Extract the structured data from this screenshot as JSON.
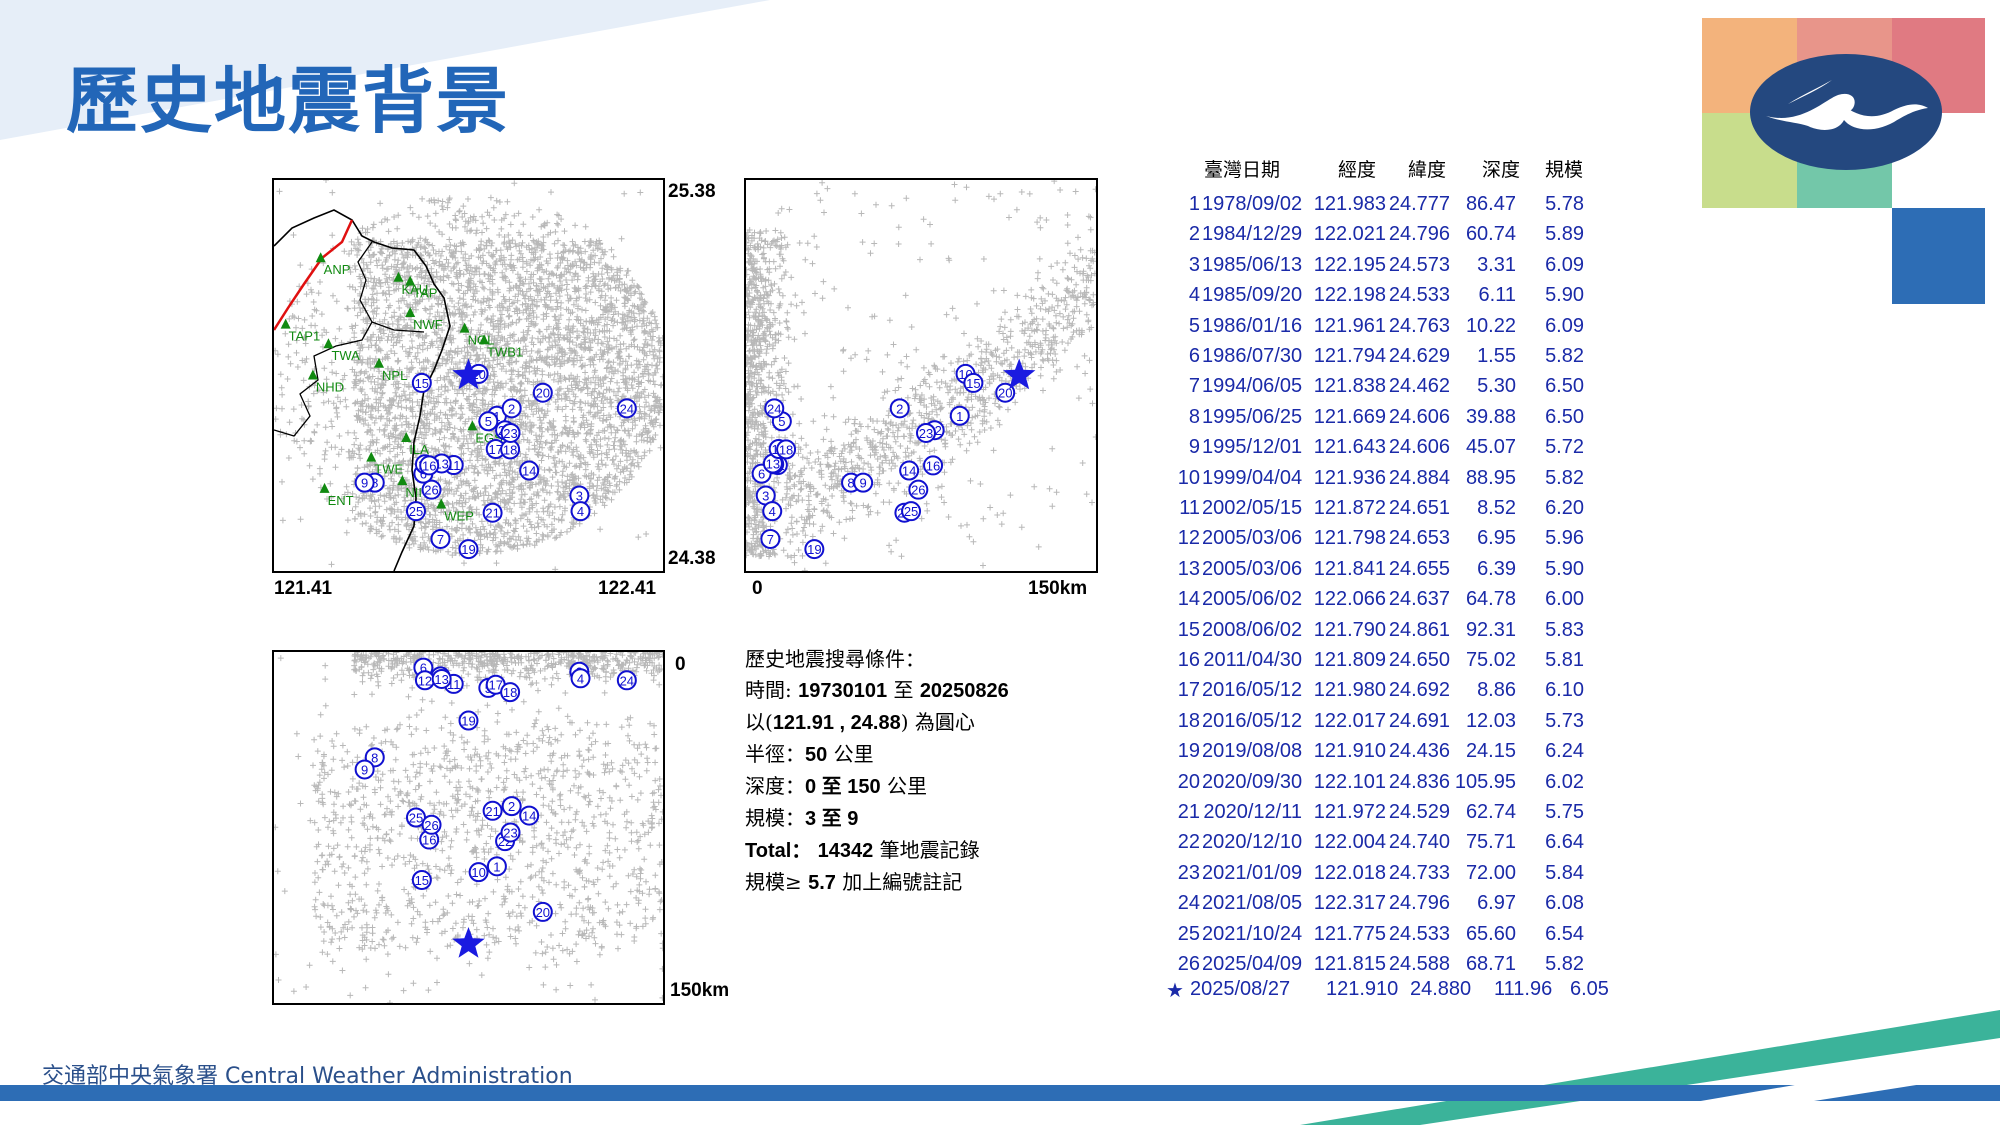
{
  "slide": {
    "title": "歷史地震背景",
    "footer": "交通部中央氣象署 Central Weather Administration",
    "colors": {
      "title": "#2266b8",
      "accent_blue": "#2d6db5",
      "accent_green": "#3bb39a",
      "logo_orange": "#f3b37c",
      "logo_pink": "#e4878a",
      "logo_lightgreen": "#c6dd8a",
      "logo_teal": "#73c7a9",
      "logo_navy": "#24487f"
    }
  },
  "map_plot": {
    "lat_top": "25.38",
    "lat_bottom": "24.38",
    "lon_left": "121.41",
    "lon_right": "122.41",
    "stations": [
      {
        "name": "ANP",
        "lon": 121.53,
        "lat": 25.18
      },
      {
        "name": "KAU",
        "lon": 121.73,
        "lat": 25.13
      },
      {
        "name": "TAP",
        "lon": 121.76,
        "lat": 25.12
      },
      {
        "name": "NWF",
        "lon": 121.76,
        "lat": 25.04
      },
      {
        "name": "NGL",
        "lon": 121.9,
        "lat": 25.0
      },
      {
        "name": "TWB1",
        "lon": 121.95,
        "lat": 24.97
      },
      {
        "name": "TAP1",
        "lon": 121.44,
        "lat": 25.01
      },
      {
        "name": "TWA",
        "lon": 121.55,
        "lat": 24.96
      },
      {
        "name": "NPL",
        "lon": 121.68,
        "lat": 24.91
      },
      {
        "name": "NHD",
        "lon": 121.51,
        "lat": 24.88
      },
      {
        "name": "EGS",
        "lon": 121.92,
        "lat": 24.75
      },
      {
        "name": "ILA",
        "lon": 121.75,
        "lat": 24.72
      },
      {
        "name": "TWE",
        "lon": 121.66,
        "lat": 24.67
      },
      {
        "name": "NII",
        "lon": 121.74,
        "lat": 24.61
      },
      {
        "name": "ENT",
        "lon": 121.54,
        "lat": 24.59
      },
      {
        "name": "WEP",
        "lon": 121.84,
        "lat": 24.55
      }
    ]
  },
  "depth_profile": {
    "origin": "0",
    "end": "150km"
  },
  "depth_section": {
    "top": "0",
    "bottom": "150km"
  },
  "query": {
    "title": "歷史地震搜尋條件：",
    "time_label": "時間:",
    "time_from": "19730101",
    "time_to_word": "至",
    "time_to": "20250826",
    "center_prefix": "以(",
    "center_coords": "121.91 , 24.88",
    "center_suffix": ") 為圓心",
    "radius_label": "半徑：",
    "radius_value": "50",
    "radius_unit": "公里",
    "depth_label": "深度：",
    "depth_value": "0 至 150",
    "depth_unit": "公里",
    "mag_label": "規模：",
    "mag_value": "3 至 9",
    "total_label": "Total：",
    "total_value": "14342",
    "total_unit": "筆地震記錄",
    "note_prefix": "規模≥",
    "note_value": "5.7",
    "note_suffix": "加上編號註記"
  },
  "table": {
    "headers": [
      "臺灣日期",
      "經度",
      "緯度",
      "深度",
      "規模"
    ],
    "rows": [
      {
        "id": "1",
        "date": "1978/09/02",
        "lon": "121.983",
        "lat": "24.777",
        "depth": "86.47",
        "mag": "5.78"
      },
      {
        "id": "2",
        "date": "1984/12/29",
        "lon": "122.021",
        "lat": "24.796",
        "depth": "60.74",
        "mag": "5.89"
      },
      {
        "id": "3",
        "date": "1985/06/13",
        "lon": "122.195",
        "lat": "24.573",
        "depth": "3.31",
        "mag": "6.09"
      },
      {
        "id": "4",
        "date": "1985/09/20",
        "lon": "122.198",
        "lat": "24.533",
        "depth": "6.11",
        "mag": "5.90"
      },
      {
        "id": "5",
        "date": "1986/01/16",
        "lon": "121.961",
        "lat": "24.763",
        "depth": "10.22",
        "mag": "6.09"
      },
      {
        "id": "6",
        "date": "1986/07/30",
        "lon": "121.794",
        "lat": "24.629",
        "depth": "1.55",
        "mag": "5.82"
      },
      {
        "id": "7",
        "date": "1994/06/05",
        "lon": "121.838",
        "lat": "24.462",
        "depth": "5.30",
        "mag": "6.50"
      },
      {
        "id": "8",
        "date": "1995/06/25",
        "lon": "121.669",
        "lat": "24.606",
        "depth": "39.88",
        "mag": "6.50"
      },
      {
        "id": "9",
        "date": "1995/12/01",
        "lon": "121.643",
        "lat": "24.606",
        "depth": "45.07",
        "mag": "5.72"
      },
      {
        "id": "10",
        "date": "1999/04/04",
        "lon": "121.936",
        "lat": "24.884",
        "depth": "88.95",
        "mag": "5.82"
      },
      {
        "id": "11",
        "date": "2002/05/15",
        "lon": "121.872",
        "lat": "24.651",
        "depth": "8.52",
        "mag": "6.20"
      },
      {
        "id": "12",
        "date": "2005/03/06",
        "lon": "121.798",
        "lat": "24.653",
        "depth": "6.95",
        "mag": "5.96"
      },
      {
        "id": "13",
        "date": "2005/03/06",
        "lon": "121.841",
        "lat": "24.655",
        "depth": "6.39",
        "mag": "5.90"
      },
      {
        "id": "14",
        "date": "2005/06/02",
        "lon": "122.066",
        "lat": "24.637",
        "depth": "64.78",
        "mag": "6.00"
      },
      {
        "id": "15",
        "date": "2008/06/02",
        "lon": "121.790",
        "lat": "24.861",
        "depth": "92.31",
        "mag": "5.83"
      },
      {
        "id": "16",
        "date": "2011/04/30",
        "lon": "121.809",
        "lat": "24.650",
        "depth": "75.02",
        "mag": "5.81"
      },
      {
        "id": "17",
        "date": "2016/05/12",
        "lon": "121.980",
        "lat": "24.692",
        "depth": "8.86",
        "mag": "6.10"
      },
      {
        "id": "18",
        "date": "2016/05/12",
        "lon": "122.017",
        "lat": "24.691",
        "depth": "12.03",
        "mag": "5.73"
      },
      {
        "id": "19",
        "date": "2019/08/08",
        "lon": "121.910",
        "lat": "24.436",
        "depth": "24.15",
        "mag": "6.24"
      },
      {
        "id": "20",
        "date": "2020/09/30",
        "lon": "122.101",
        "lat": "24.836",
        "depth": "105.95",
        "mag": "6.02"
      },
      {
        "id": "21",
        "date": "2020/12/11",
        "lon": "121.972",
        "lat": "24.529",
        "depth": "62.74",
        "mag": "5.75"
      },
      {
        "id": "22",
        "date": "2020/12/10",
        "lon": "122.004",
        "lat": "24.740",
        "depth": "75.71",
        "mag": "6.64"
      },
      {
        "id": "23",
        "date": "2021/01/09",
        "lon": "122.018",
        "lat": "24.733",
        "depth": "72.00",
        "mag": "5.84"
      },
      {
        "id": "24",
        "date": "2021/08/05",
        "lon": "122.317",
        "lat": "24.796",
        "depth": "6.97",
        "mag": "6.08"
      },
      {
        "id": "25",
        "date": "2021/10/24",
        "lon": "121.775",
        "lat": "24.533",
        "depth": "65.60",
        "mag": "6.54"
      },
      {
        "id": "26",
        "date": "2025/04/09",
        "lon": "121.815",
        "lat": "24.588",
        "depth": "68.71",
        "mag": "5.82"
      }
    ],
    "current": {
      "marker": "★",
      "date": "2025/08/27",
      "lon": "121.910",
      "lat": "24.880",
      "depth": "111.96",
      "mag": "6.05"
    }
  }
}
